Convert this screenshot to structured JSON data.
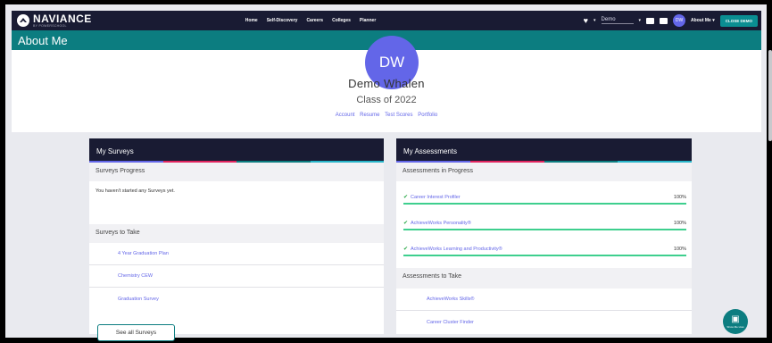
{
  "nav": {
    "brand": "NAVIANCE",
    "brand_sub": "BY POWERSCHOOL",
    "items": [
      "Home",
      "Self-Discovery",
      "Careers",
      "Colleges",
      "Planner"
    ],
    "demo_select": "Demo",
    "avatar_initials": "DW",
    "about_me": "About Me",
    "close_demo": "CLOSE DEMO"
  },
  "page_title": "About Me",
  "profile": {
    "initials": "DW",
    "name": "Demo Whalen",
    "class_of": "Class of 2022",
    "links": [
      "Account",
      "Resume",
      "Test Scores",
      "Portfolio"
    ]
  },
  "surveys": {
    "title": "My Surveys",
    "progress_heading": "Surveys Progress",
    "empty_message": "You haven't started any Surveys yet.",
    "to_take_heading": "Surveys to Take",
    "items": [
      "4 Year Graduation Plan",
      "Chemistry CEW",
      "Graduation Survey"
    ],
    "see_all": "See all Surveys"
  },
  "assessments": {
    "title": "My Assessments",
    "progress_heading": "Assessments in Progress",
    "in_progress": [
      {
        "name": "Career Interest Profiler",
        "percent": "100%",
        "progress": 1.0
      },
      {
        "name": "AchieveWorks Personality®",
        "percent": "100%",
        "progress": 1.0
      },
      {
        "name": "AchieveWorks Learning and Productivity®",
        "percent": "100%",
        "progress": 1.0
      }
    ],
    "to_take_heading": "Assessments to Take",
    "to_take": [
      "AchieveWorks Skills®",
      "Career Cluster Finder"
    ]
  },
  "help": {
    "label": "Show Me How"
  },
  "colors": {
    "navy": "#191b33",
    "teal": "#0c7d80",
    "accent": "#6366e8",
    "progress": "#3ecf8e",
    "stripe": [
      "#6366e8",
      "#e0245e",
      "#0c7d80",
      "#27b5c9"
    ]
  }
}
